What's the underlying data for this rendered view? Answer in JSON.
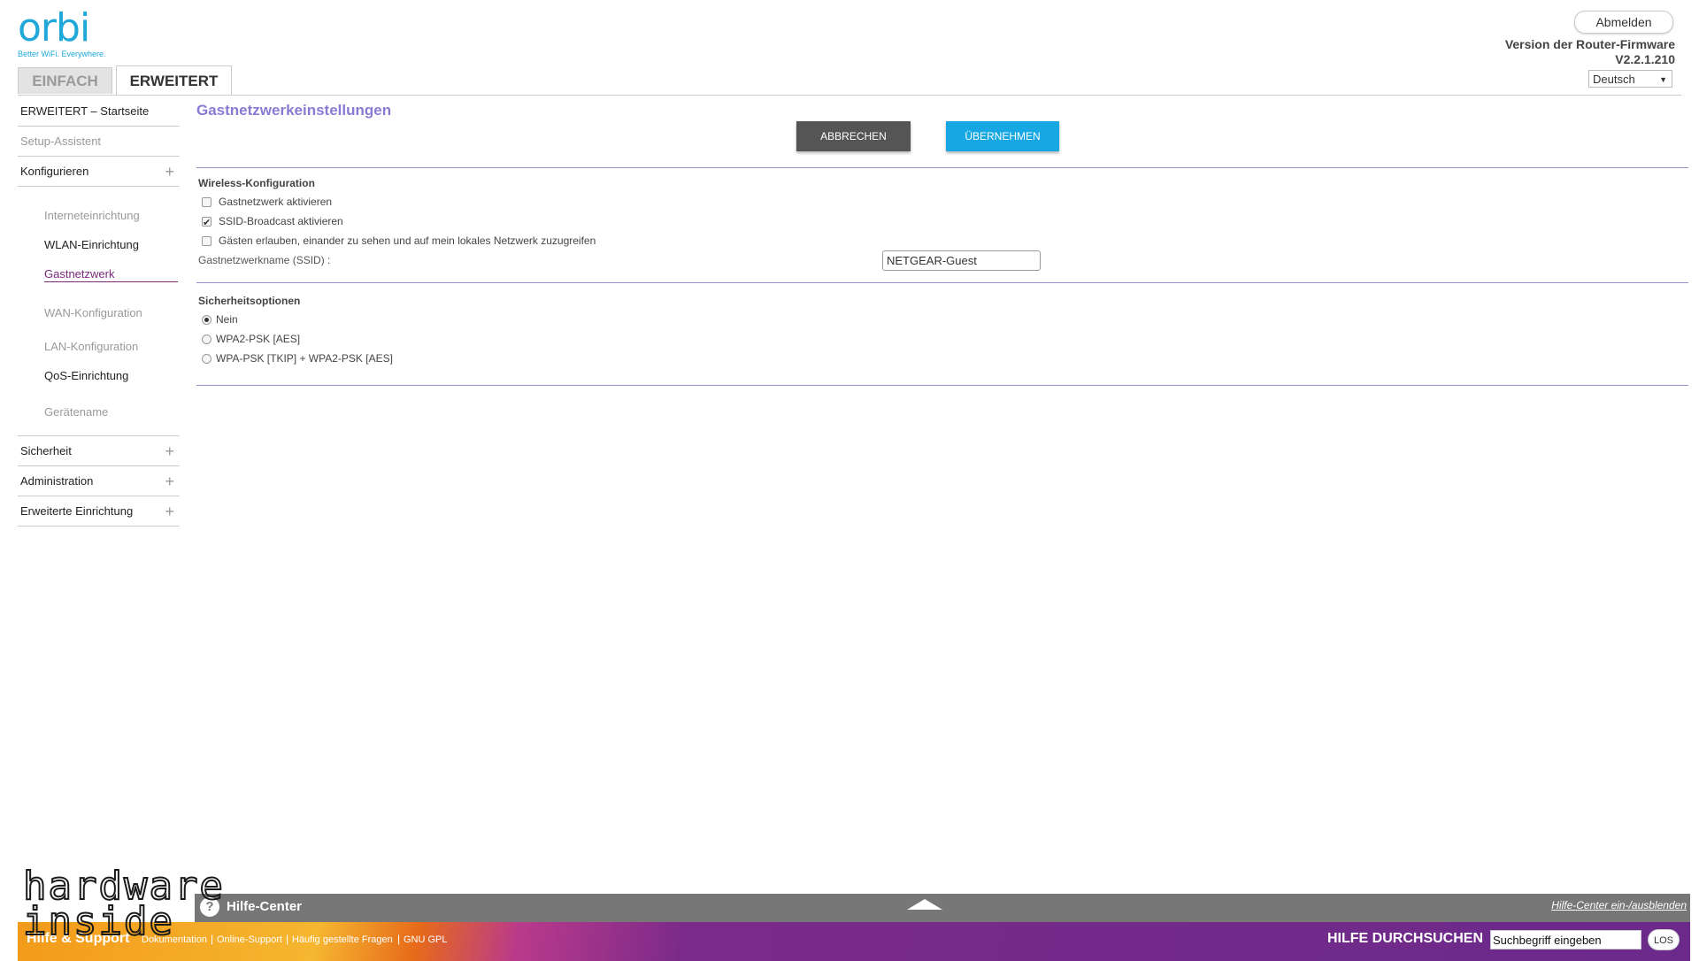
{
  "logo": {
    "word": "orbi",
    "tagline": "Better WiFi. Everywhere."
  },
  "header": {
    "logout_label": "Abmelden",
    "firmware_label": "Version der Router-Firmware",
    "firmware_version": "V2.2.1.210",
    "language": "Deutsch"
  },
  "tabs": {
    "basic": "EINFACH",
    "advanced": "ERWEITERT"
  },
  "sidebar": {
    "home": "ERWEITERT – Startseite",
    "setup_wizard": "Setup-Assistent",
    "configure": "Konfigurieren",
    "sub": {
      "internet": "Interneteinrichtung",
      "wlan": "WLAN-Einrichtung",
      "guest": "Gastnetzwerk",
      "wan": "WAN-Konfiguration",
      "lan": "LAN-Konfiguration",
      "qos": "QoS-Einrichtung",
      "device_name": "Gerätename"
    },
    "security": "Sicherheit",
    "administration": "Administration",
    "advanced_setup": "Erweiterte Einrichtung"
  },
  "main": {
    "title": "Gastnetzwerkeinstellungen",
    "cancel_label": "ABBRECHEN",
    "apply_label": "ÜBERNEHMEN",
    "wireless": {
      "heading": "Wireless-Konfiguration",
      "enable_guest": {
        "label": "Gastnetzwerk aktivieren",
        "checked": false
      },
      "ssid_broadcast": {
        "label": "SSID-Broadcast aktivieren",
        "checked": true
      },
      "allow_guests": {
        "label": "Gästen erlauben, einander zu sehen und auf mein lokales Netzwerk zuzugreifen",
        "checked": false
      },
      "ssid_label": "Gastnetzwerkname (SSID) :",
      "ssid_value": "NETGEAR-Guest"
    },
    "security": {
      "heading": "Sicherheitsoptionen",
      "options": [
        {
          "label": "Nein",
          "selected": true
        },
        {
          "label": "WPA2-PSK [AES]",
          "selected": false
        },
        {
          "label": "WPA-PSK [TKIP] + WPA2-PSK [AES]",
          "selected": false
        }
      ]
    }
  },
  "footer": {
    "help_center": "Hilfe-Center",
    "help_toggle": "Hilfe-Center ein-/ausblenden",
    "support_title": "Hilfe & Support",
    "links": [
      "Dokumentation",
      "Online-Support",
      "Häufig gestellte Fragen",
      "GNU GPL"
    ],
    "search_label": "HILFE DURCHSUCHEN",
    "search_value": "Suchbegriff eingeben",
    "search_button": "LOS"
  },
  "watermark": {
    "text": "hardware inside"
  },
  "colors": {
    "accent_purple": "#8a7ad4",
    "active_link": "#7a2a7a",
    "apply_blue": "#17a8e3",
    "cancel_grey": "#555555"
  }
}
